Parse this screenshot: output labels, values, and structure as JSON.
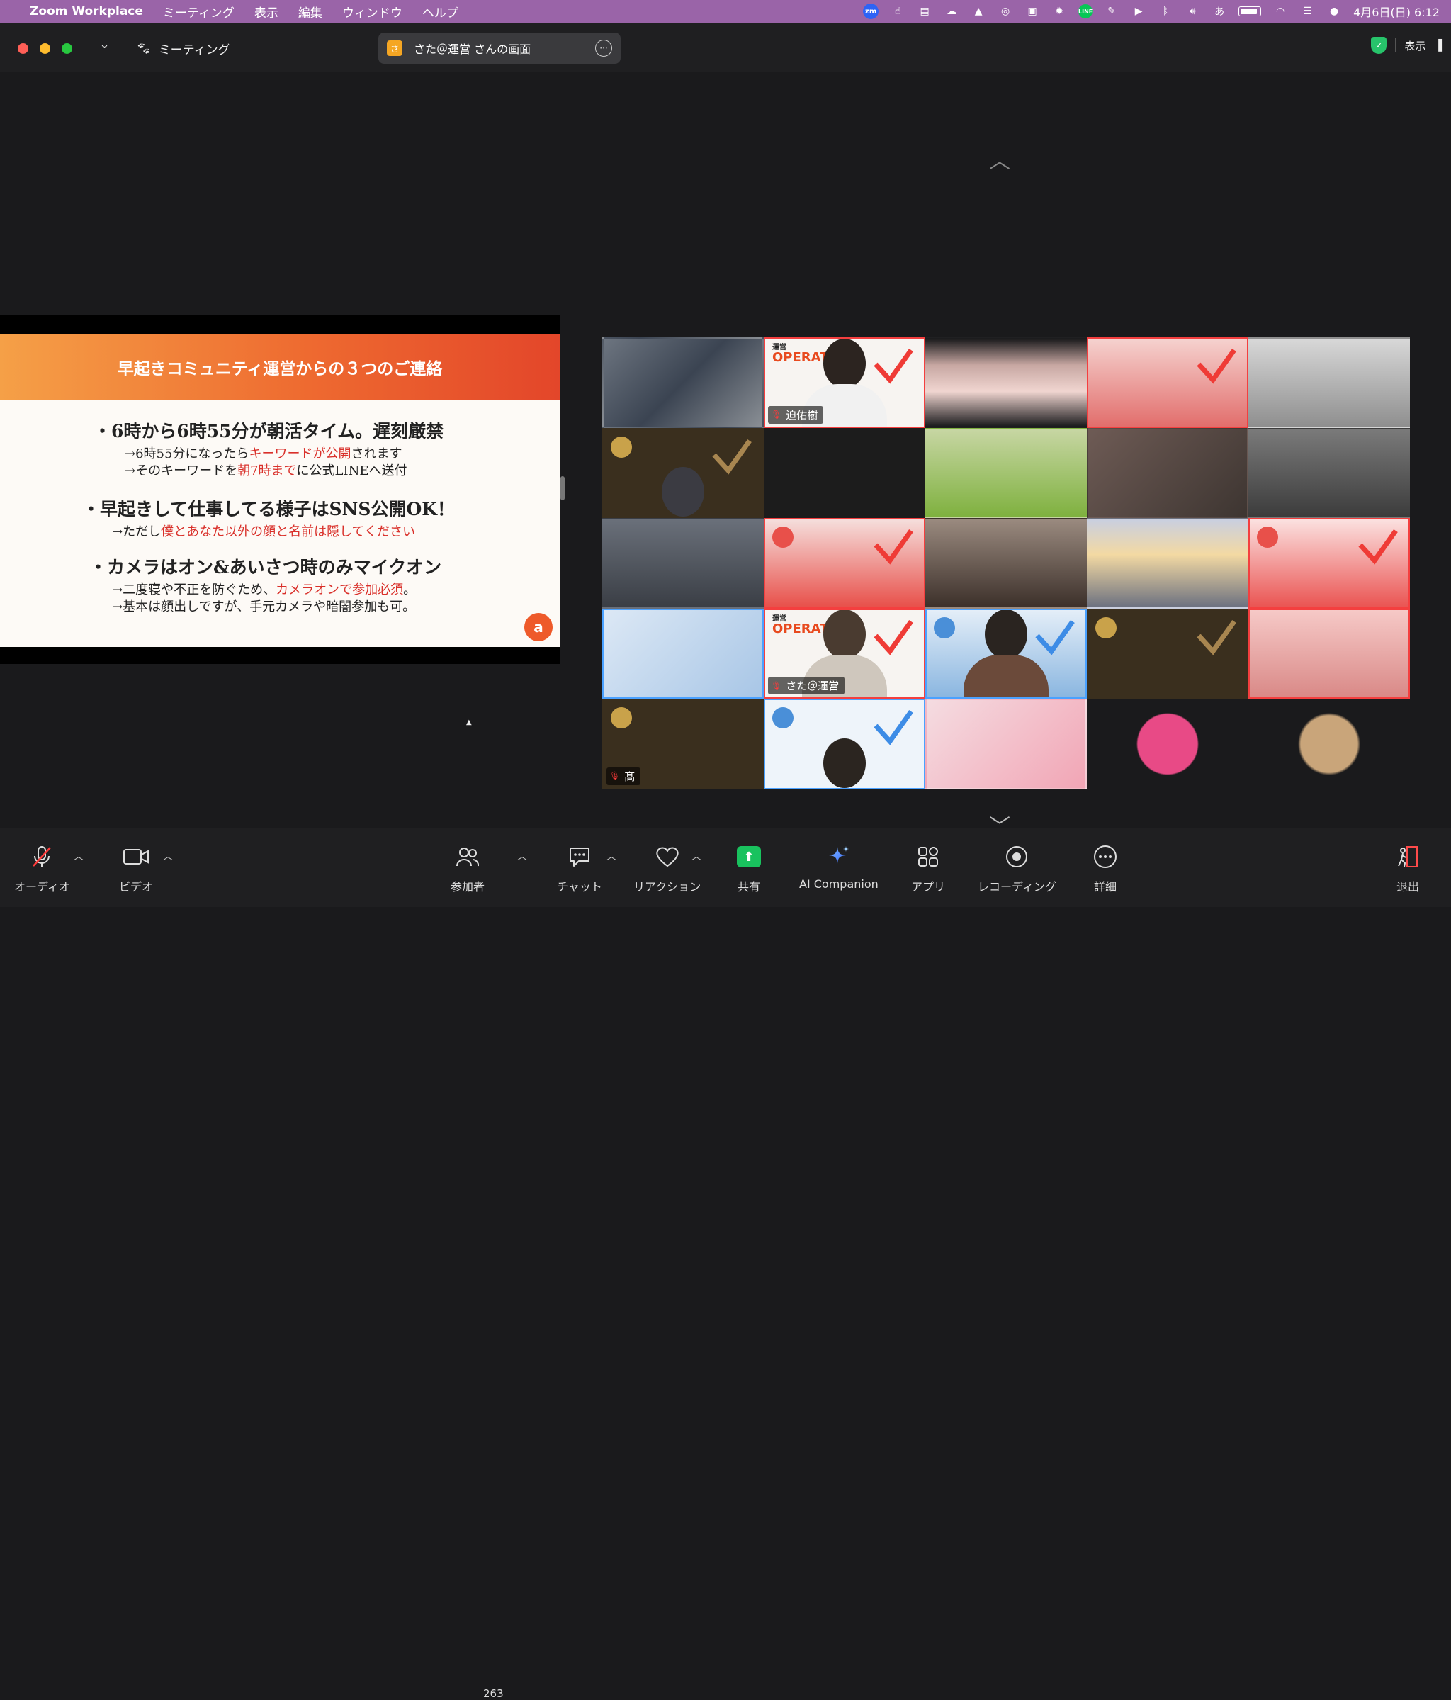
{
  "menubar": {
    "app_name": "Zoom Workplace",
    "items": [
      "ミーティング",
      "表示",
      "編集",
      "ウィンドウ",
      "ヘルプ"
    ],
    "zoom_icon_text": "zm",
    "line_icon_text": "LINE",
    "ime_text": "あ",
    "clock": "4月6日(日) 6:12"
  },
  "window": {
    "meeting_label": "ミーティング",
    "share_title": "さた＠運営 さんの画面",
    "share_avatar_text": "さ",
    "view_label": "表示"
  },
  "slide": {
    "title": "早起きコミュニティ運営からの３つのご連絡",
    "b1_main": "・6時から6時55分が朝活タイム。遅刻厳禁",
    "b1_sub1_pre": "→6時55分になったら",
    "b1_sub1_red": "キーワードが公開",
    "b1_sub1_post": "されます",
    "b1_sub2_pre": "→そのキーワードを",
    "b1_sub2_red": "朝7時まで",
    "b1_sub2_post": "に公式LINEへ送付",
    "b2_main": "・早起きして仕事してる様子はSNS公開OK！",
    "b2_sub_pre": "→ただし",
    "b2_sub_red": "僕とあなた以外の顔と名前は隠してください",
    "b3_main": "・カメラはオン&あいさつ時のみマイクオン",
    "b3_sub1_pre": "→二度寝や不正を防ぐため、",
    "b3_sub1_red": "カメラオンで参加必須",
    "b3_sub1_post": "。",
    "b3_sub2": "→基本は顔出しですが、手元カメラや暗闇参加も可。"
  },
  "gallery": {
    "operator_small": "運営",
    "operator_big": "OPERATOR",
    "name_1": "迫佑樹",
    "name_2": "さた＠運営",
    "name_3": "髙"
  },
  "toolbar": {
    "audio": "オーディオ",
    "video": "ビデオ",
    "participants": "参加者",
    "participants_count": "263",
    "chat": "チャット",
    "reactions": "リアクション",
    "share": "共有",
    "ai_companion": "AI Companion",
    "apps": "アプリ",
    "recording": "レコーディング",
    "more": "詳細",
    "leave": "退出"
  },
  "colors": {
    "menubar_bg": "#9a64a8",
    "active_speaker_border": "#f43f3f",
    "share_green": "#19c25e",
    "slide_accent": "#ee6a30"
  }
}
